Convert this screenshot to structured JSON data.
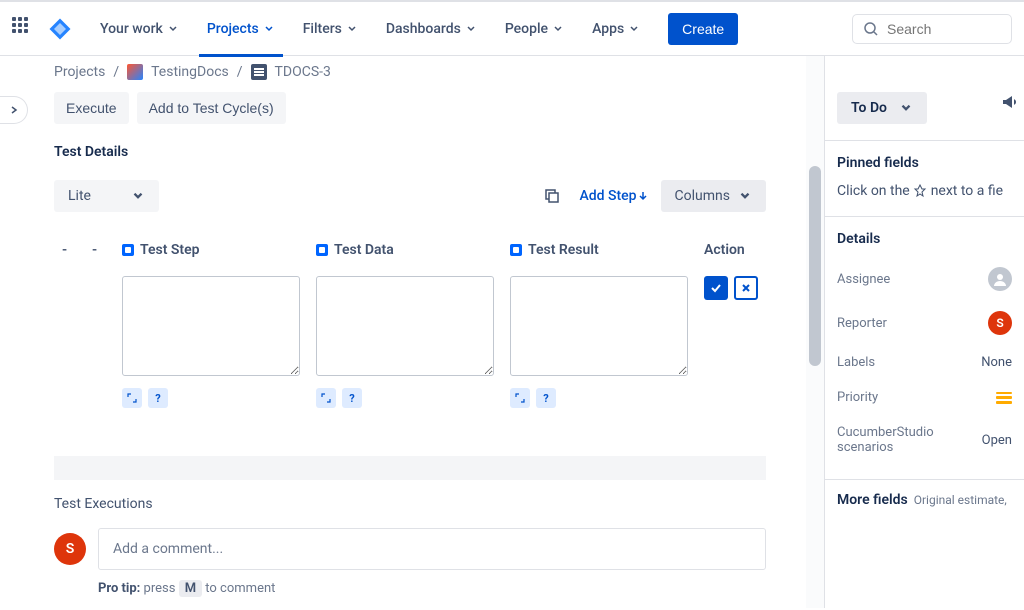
{
  "nav": {
    "items": [
      "Your work",
      "Projects",
      "Filters",
      "Dashboards",
      "People",
      "Apps"
    ],
    "active_index": 1,
    "create": "Create",
    "search_placeholder": "Search"
  },
  "breadcrumb": {
    "root": "Projects",
    "project": "TestingDocs",
    "issue": "TDOCS-3"
  },
  "actions": {
    "execute": "Execute",
    "add_to_cycle": "Add to Test Cycle(s)"
  },
  "test_details": {
    "title": "Test Details",
    "mode": "Lite",
    "add_step": "Add Step",
    "columns": "Columns",
    "headers": {
      "step": "Test Step",
      "data": "Test Data",
      "result": "Test Result",
      "action": "Action"
    },
    "rows": [
      {
        "step": "",
        "data": "",
        "result": ""
      }
    ]
  },
  "executions": {
    "title": "Test Executions"
  },
  "comment": {
    "avatar_initial": "S",
    "placeholder": "Add a comment...",
    "protip_label": "Pro tip:",
    "protip_before": " press ",
    "protip_key": "M",
    "protip_after": " to comment"
  },
  "right": {
    "status": "To Do",
    "pinned": {
      "title": "Pinned fields",
      "text_before": "Click on the ",
      "text_after": " next to a fie"
    },
    "details": {
      "title": "Details",
      "assignee_label": "Assignee",
      "reporter_label": "Reporter",
      "reporter_initial": "S",
      "labels_label": "Labels",
      "labels_value": "None",
      "priority_label": "Priority",
      "cucumber_label": "CucumberStudio scenarios",
      "cucumber_value": "Open"
    },
    "more_fields": {
      "title": "More fields",
      "sub": "Original estimate,"
    }
  }
}
